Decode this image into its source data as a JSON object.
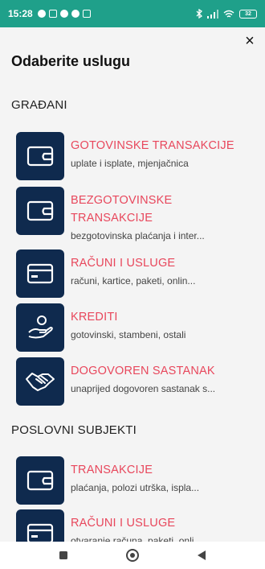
{
  "status_bar": {
    "time": "15:28",
    "battery": "32",
    "background_color": "#1fa08a"
  },
  "sheet": {
    "close_label": "×",
    "title": "Odaberite uslugu"
  },
  "sections": [
    {
      "label": "GRAĐANI",
      "items": [
        {
          "icon": "wallet-icon",
          "title": "GOTOVINSKE TRANSAKCIJE",
          "subtitle": "uplate i isplate, mjenjačnica"
        },
        {
          "icon": "wallet-icon",
          "title": "BEZGOTOVINSKE TRANSAKCIJE",
          "subtitle": "bezgotovinska plaćanja i inter..."
        },
        {
          "icon": "card-icon",
          "title": "RAČUNI I USLUGE",
          "subtitle": "računi, kartice, paketi, onlin..."
        },
        {
          "icon": "hand-coin-icon",
          "title": "KREDITI",
          "subtitle": "gotovinski, stambeni, ostali"
        },
        {
          "icon": "handshake-icon",
          "title": "DOGOVOREN SASTANAK",
          "subtitle": "unaprijed dogovoren sastanak s..."
        }
      ]
    },
    {
      "label": "POSLOVNI SUBJEKTI",
      "items": [
        {
          "icon": "wallet-icon",
          "title": "TRANSAKCIJE",
          "subtitle": "plaćanja, polozi utrška, ispla..."
        },
        {
          "icon": "card-icon",
          "title": "RAČUNI I USLUGE",
          "subtitle": "otvaranje računa, paketi, onli..."
        }
      ]
    }
  ],
  "colors": {
    "accent": "#e8475c",
    "tile": "#0f2a4e"
  }
}
